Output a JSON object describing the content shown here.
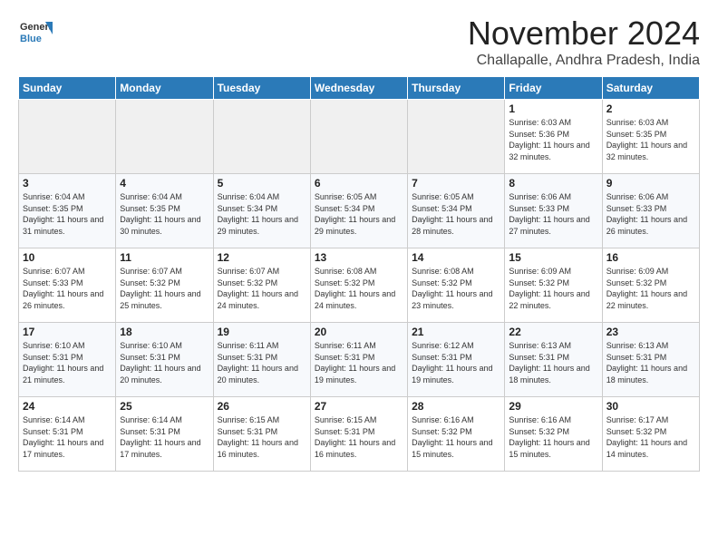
{
  "header": {
    "logo_general": "General",
    "logo_blue": "Blue",
    "month_year": "November 2024",
    "location": "Challapalle, Andhra Pradesh, India"
  },
  "weekdays": [
    "Sunday",
    "Monday",
    "Tuesday",
    "Wednesday",
    "Thursday",
    "Friday",
    "Saturday"
  ],
  "weeks": [
    [
      {
        "day": "",
        "empty": true
      },
      {
        "day": "",
        "empty": true
      },
      {
        "day": "",
        "empty": true
      },
      {
        "day": "",
        "empty": true
      },
      {
        "day": "",
        "empty": true
      },
      {
        "day": "1",
        "sunrise": "6:03 AM",
        "sunset": "5:36 PM",
        "daylight": "11 hours and 32 minutes."
      },
      {
        "day": "2",
        "sunrise": "6:03 AM",
        "sunset": "5:35 PM",
        "daylight": "11 hours and 32 minutes."
      }
    ],
    [
      {
        "day": "3",
        "sunrise": "6:04 AM",
        "sunset": "5:35 PM",
        "daylight": "11 hours and 31 minutes."
      },
      {
        "day": "4",
        "sunrise": "6:04 AM",
        "sunset": "5:35 PM",
        "daylight": "11 hours and 30 minutes."
      },
      {
        "day": "5",
        "sunrise": "6:04 AM",
        "sunset": "5:34 PM",
        "daylight": "11 hours and 29 minutes."
      },
      {
        "day": "6",
        "sunrise": "6:05 AM",
        "sunset": "5:34 PM",
        "daylight": "11 hours and 29 minutes."
      },
      {
        "day": "7",
        "sunrise": "6:05 AM",
        "sunset": "5:34 PM",
        "daylight": "11 hours and 28 minutes."
      },
      {
        "day": "8",
        "sunrise": "6:06 AM",
        "sunset": "5:33 PM",
        "daylight": "11 hours and 27 minutes."
      },
      {
        "day": "9",
        "sunrise": "6:06 AM",
        "sunset": "5:33 PM",
        "daylight": "11 hours and 26 minutes."
      }
    ],
    [
      {
        "day": "10",
        "sunrise": "6:07 AM",
        "sunset": "5:33 PM",
        "daylight": "11 hours and 26 minutes."
      },
      {
        "day": "11",
        "sunrise": "6:07 AM",
        "sunset": "5:32 PM",
        "daylight": "11 hours and 25 minutes."
      },
      {
        "day": "12",
        "sunrise": "6:07 AM",
        "sunset": "5:32 PM",
        "daylight": "11 hours and 24 minutes."
      },
      {
        "day": "13",
        "sunrise": "6:08 AM",
        "sunset": "5:32 PM",
        "daylight": "11 hours and 24 minutes."
      },
      {
        "day": "14",
        "sunrise": "6:08 AM",
        "sunset": "5:32 PM",
        "daylight": "11 hours and 23 minutes."
      },
      {
        "day": "15",
        "sunrise": "6:09 AM",
        "sunset": "5:32 PM",
        "daylight": "11 hours and 22 minutes."
      },
      {
        "day": "16",
        "sunrise": "6:09 AM",
        "sunset": "5:32 PM",
        "daylight": "11 hours and 22 minutes."
      }
    ],
    [
      {
        "day": "17",
        "sunrise": "6:10 AM",
        "sunset": "5:31 PM",
        "daylight": "11 hours and 21 minutes."
      },
      {
        "day": "18",
        "sunrise": "6:10 AM",
        "sunset": "5:31 PM",
        "daylight": "11 hours and 20 minutes."
      },
      {
        "day": "19",
        "sunrise": "6:11 AM",
        "sunset": "5:31 PM",
        "daylight": "11 hours and 20 minutes."
      },
      {
        "day": "20",
        "sunrise": "6:11 AM",
        "sunset": "5:31 PM",
        "daylight": "11 hours and 19 minutes."
      },
      {
        "day": "21",
        "sunrise": "6:12 AM",
        "sunset": "5:31 PM",
        "daylight": "11 hours and 19 minutes."
      },
      {
        "day": "22",
        "sunrise": "6:13 AM",
        "sunset": "5:31 PM",
        "daylight": "11 hours and 18 minutes."
      },
      {
        "day": "23",
        "sunrise": "6:13 AM",
        "sunset": "5:31 PM",
        "daylight": "11 hours and 18 minutes."
      }
    ],
    [
      {
        "day": "24",
        "sunrise": "6:14 AM",
        "sunset": "5:31 PM",
        "daylight": "11 hours and 17 minutes."
      },
      {
        "day": "25",
        "sunrise": "6:14 AM",
        "sunset": "5:31 PM",
        "daylight": "11 hours and 17 minutes."
      },
      {
        "day": "26",
        "sunrise": "6:15 AM",
        "sunset": "5:31 PM",
        "daylight": "11 hours and 16 minutes."
      },
      {
        "day": "27",
        "sunrise": "6:15 AM",
        "sunset": "5:31 PM",
        "daylight": "11 hours and 16 minutes."
      },
      {
        "day": "28",
        "sunrise": "6:16 AM",
        "sunset": "5:32 PM",
        "daylight": "11 hours and 15 minutes."
      },
      {
        "day": "29",
        "sunrise": "6:16 AM",
        "sunset": "5:32 PM",
        "daylight": "11 hours and 15 minutes."
      },
      {
        "day": "30",
        "sunrise": "6:17 AM",
        "sunset": "5:32 PM",
        "daylight": "11 hours and 14 minutes."
      }
    ]
  ]
}
